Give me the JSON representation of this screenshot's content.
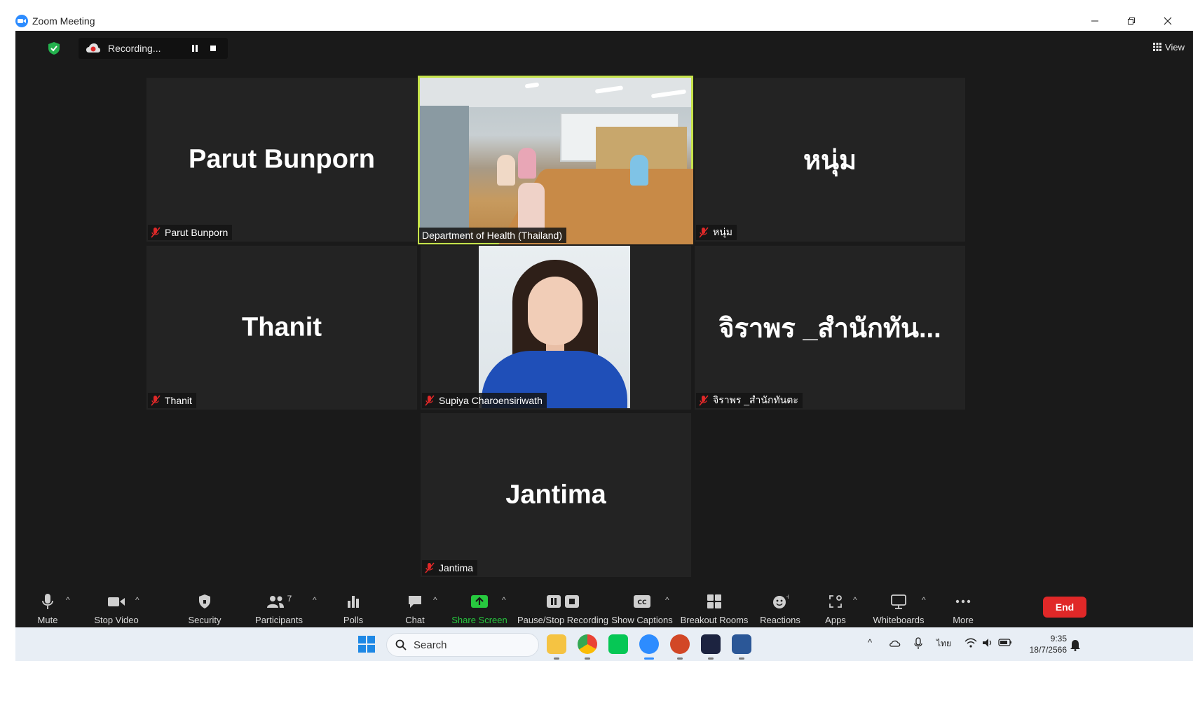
{
  "window": {
    "title": "Zoom Meeting"
  },
  "recording": {
    "label": "Recording..."
  },
  "view": {
    "label": "View"
  },
  "tiles": [
    {
      "big_name": "Parut Bunporn",
      "tag": "Parut Bunporn"
    },
    {
      "big_name": "",
      "tag": "Department of Health (Thailand)"
    },
    {
      "big_name": "หนุ่ม",
      "tag": "หนุ่ม"
    },
    {
      "big_name": "Thanit",
      "tag": "Thanit"
    },
    {
      "big_name": "",
      "tag": "Supiya Charoensiriwath"
    },
    {
      "big_name": "จิราพร _สำนักทัน...",
      "tag": "จิราพร _สำนักทันตะ"
    },
    {
      "big_name": "Jantima",
      "tag": "Jantima"
    }
  ],
  "toolbar": {
    "mute": "Mute",
    "stop_video": "Stop Video",
    "security": "Security",
    "participants": "Participants",
    "participants_count": "7",
    "polls": "Polls",
    "chat": "Chat",
    "share_screen": "Share Screen",
    "pause_stop_recording": "Pause/Stop Recording",
    "show_captions": "Show Captions",
    "breakout_rooms": "Breakout Rooms",
    "reactions": "Reactions",
    "apps": "Apps",
    "whiteboards": "Whiteboards",
    "more": "More",
    "end": "End"
  },
  "taskbar": {
    "search_placeholder": "Search",
    "language": "ไทย",
    "time": "9:35",
    "date": "18/7/2566"
  },
  "colors": {
    "meeting_bg": "#1a1a1a",
    "tile_bg": "#232323",
    "active_speaker": "#C6E34B",
    "share_green": "#27c93f",
    "end_red": "#e02828",
    "zoom_blue": "#2D8CFF"
  }
}
